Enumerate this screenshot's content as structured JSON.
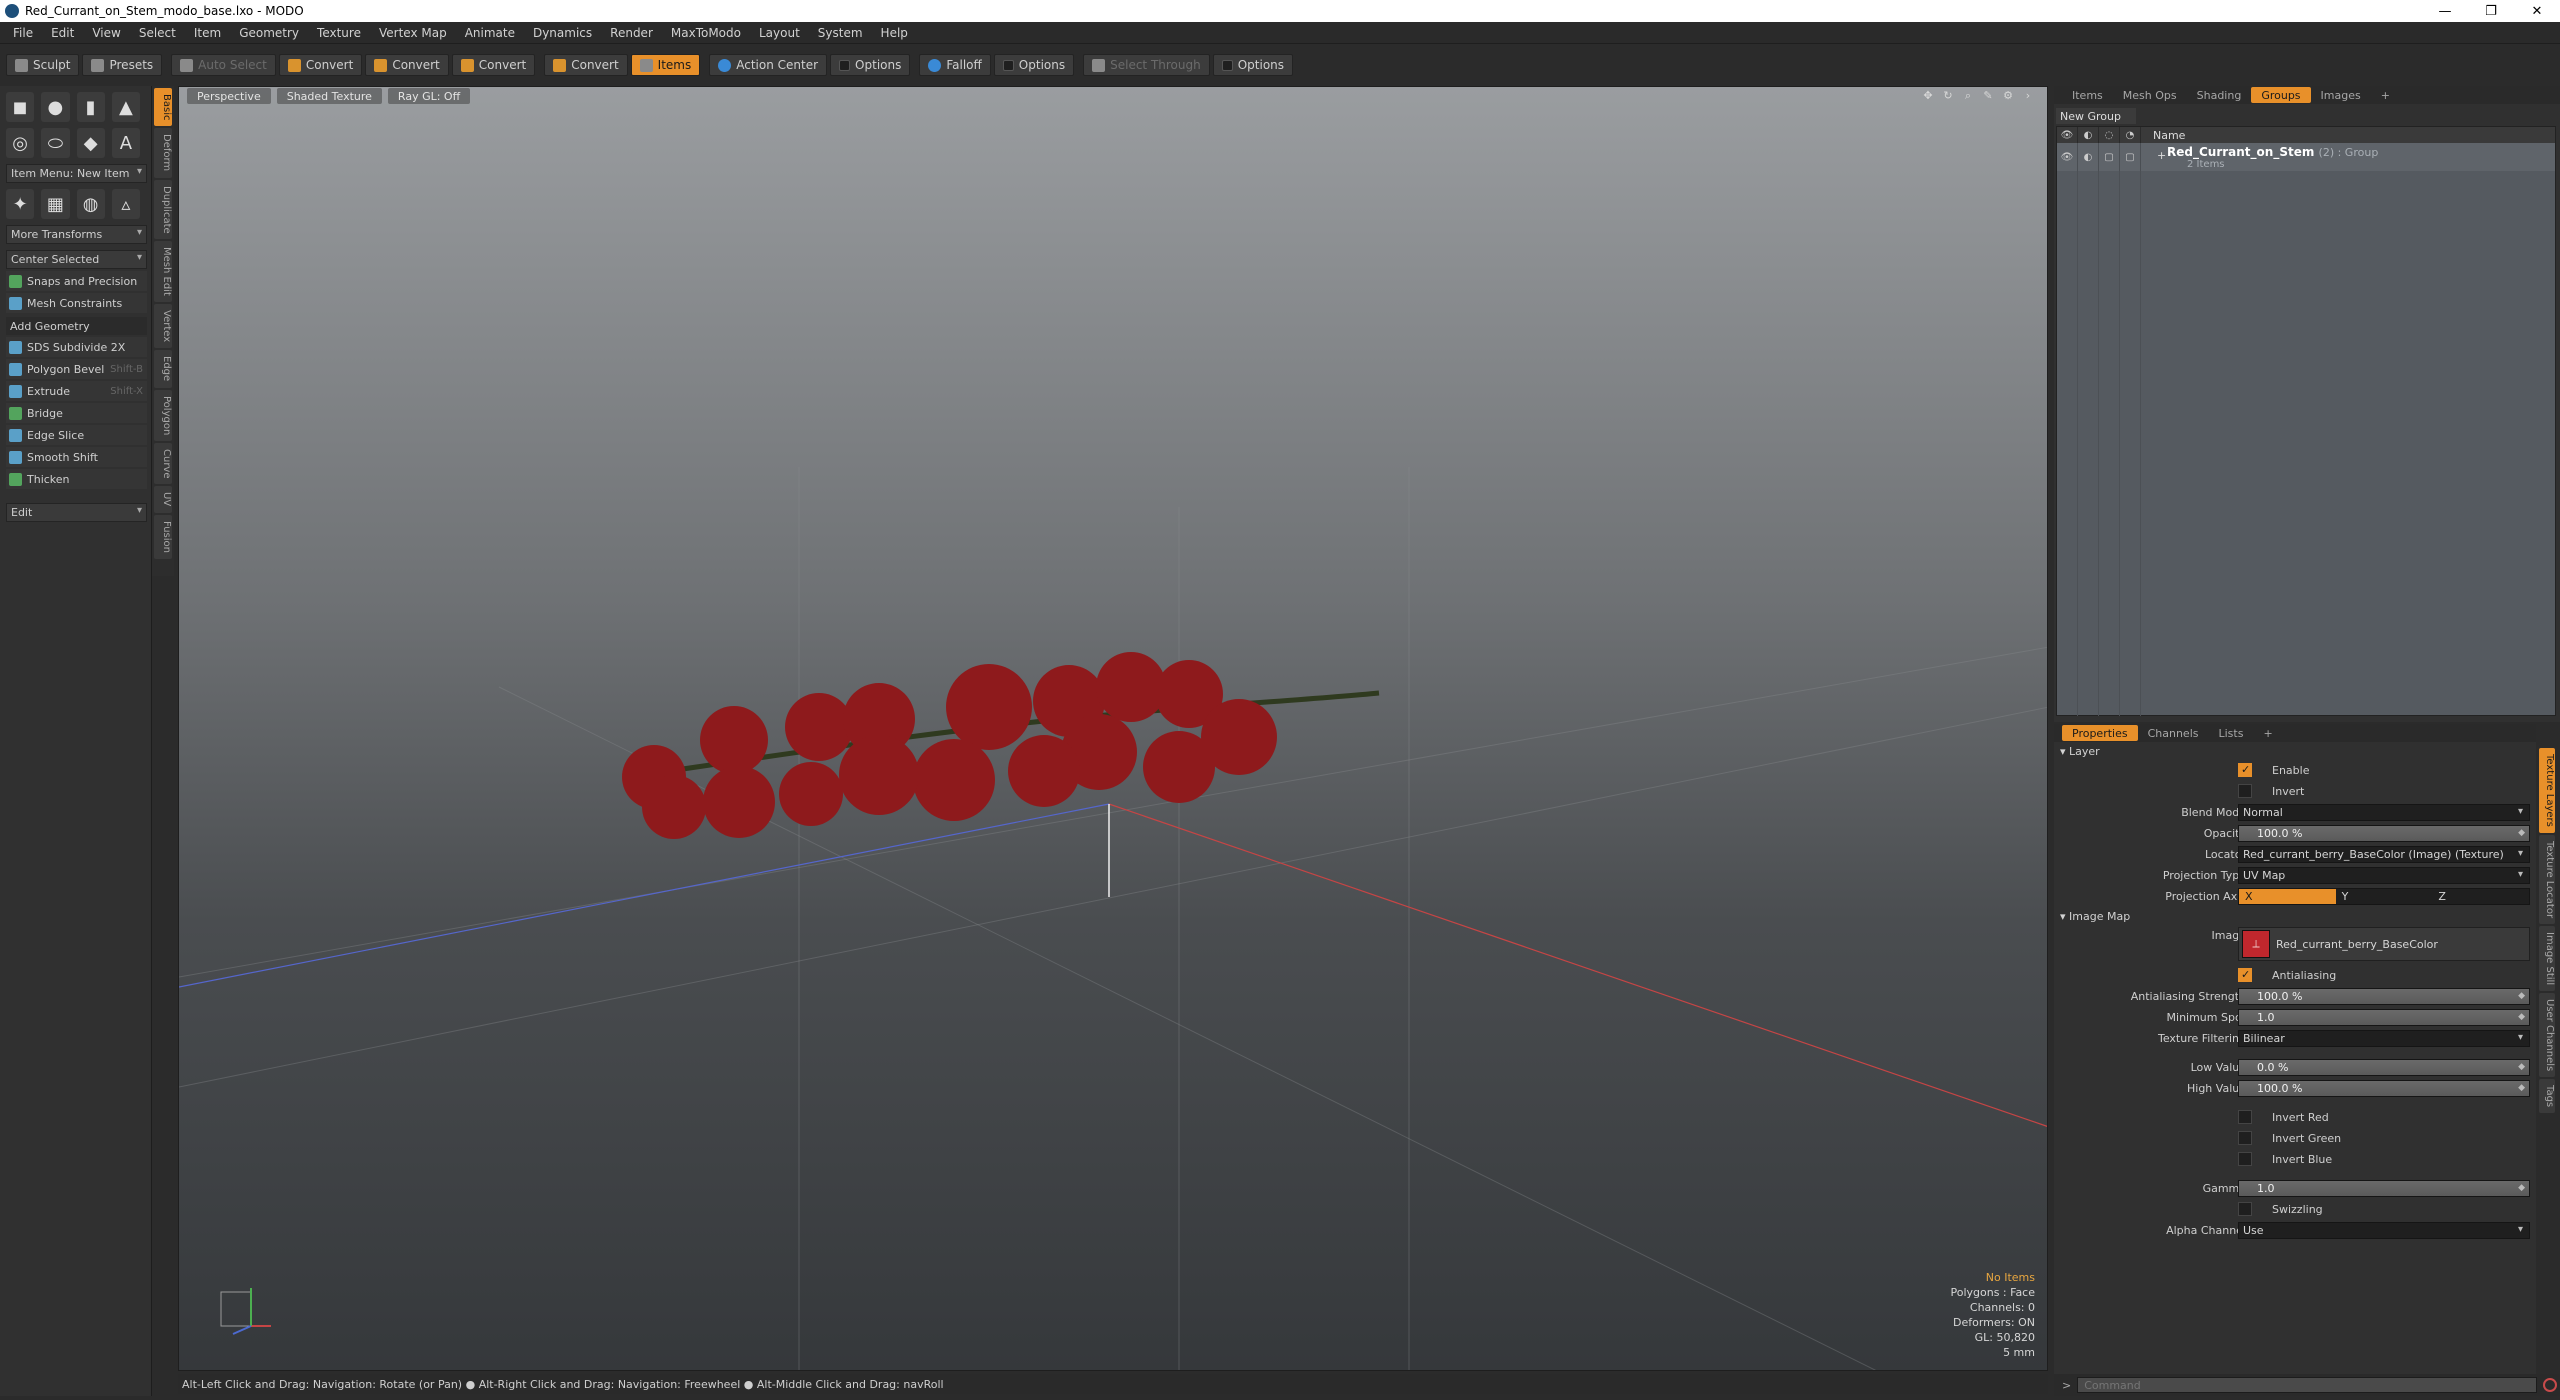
{
  "window": {
    "title": "Red_Currant_on_Stem_modo_base.lxo - MODO",
    "controls": [
      "—",
      "❐",
      "✕"
    ]
  },
  "menubar": [
    "File",
    "Edit",
    "View",
    "Select",
    "Item",
    "Geometry",
    "Texture",
    "Vertex Map",
    "Animate",
    "Dynamics",
    "Render",
    "MaxToModo",
    "Layout",
    "System",
    "Help"
  ],
  "toolbar": {
    "sculpt": "Sculpt",
    "presets": "Presets",
    "auto_select": "Auto Select",
    "convert1": "Convert",
    "convert2": "Convert",
    "convert3": "Convert",
    "convert4": "Convert",
    "items": "Items",
    "action_center": "Action Center",
    "options1": "Options",
    "falloff": "Falloff",
    "options2": "Options",
    "select_through": "Select Through",
    "options3": "Options"
  },
  "left_panel": {
    "item_menu": "Item Menu: New Item",
    "more_transforms": "More Transforms",
    "center_selected": "Center Selected",
    "snaps": "Snaps and Precision",
    "mesh_constraints": "Mesh Constraints",
    "add_geometry": "Add Geometry",
    "tools": [
      {
        "label": "SDS Subdivide 2X",
        "shortcut": ""
      },
      {
        "label": "Polygon Bevel",
        "shortcut": "Shift-B"
      },
      {
        "label": "Extrude",
        "shortcut": "Shift-X"
      },
      {
        "label": "Bridge",
        "shortcut": ""
      },
      {
        "label": "Edge Slice",
        "shortcut": ""
      },
      {
        "label": "Smooth Shift",
        "shortcut": ""
      },
      {
        "label": "Thicken",
        "shortcut": ""
      }
    ],
    "edit": "Edit",
    "vtabs": [
      "Basic",
      "Deform",
      "Duplicate",
      "Mesh Edit",
      "Vertex",
      "Edge",
      "Polygon",
      "Curve",
      "UV",
      "Fusion"
    ]
  },
  "viewport": {
    "tabs": [
      "Perspective",
      "Shaded Texture",
      "Ray GL: Off"
    ],
    "stats": {
      "no_items": "No Items",
      "polygons": "Polygons : Face",
      "channels": "Channels: 0",
      "deformers": "Deformers: ON",
      "gl": "GL: 50,820",
      "scale": "5 mm"
    },
    "colors": {
      "berry": "#8e1a1c",
      "stem": "#2f3a1f",
      "grid": "#8a8d90"
    }
  },
  "statusbar": "Alt-Left Click and Drag: Navigation: Rotate (or Pan) ● Alt-Right Click and Drag: Navigation: Freewheel ● Alt-Middle Click and Drag: navRoll",
  "right_top": {
    "tabs": [
      "Items",
      "Mesh Ops",
      "Shading",
      "Groups",
      "Images",
      "+"
    ],
    "new_group": "New Group",
    "column_name": "Name",
    "group": {
      "name": "Red_Currant_on_Stem",
      "suffix": "(2) : Group",
      "count": "2 Items"
    }
  },
  "properties": {
    "tabs": [
      "Properties",
      "Channels",
      "Lists",
      "+"
    ],
    "layer_section": "Layer",
    "enable": "Enable",
    "invert": "Invert",
    "blend_mode": {
      "label": "Blend Mode",
      "value": "Normal"
    },
    "opacity": {
      "label": "Opacity",
      "value": "100.0 %"
    },
    "locator": {
      "label": "Locator",
      "value": "Red_currant_berry_BaseColor (Image) (Texture)"
    },
    "projection_type": {
      "label": "Projection Type",
      "value": "UV Map"
    },
    "projection_axis": {
      "label": "Projection Axis",
      "x": "X",
      "y": "Y",
      "z": "Z"
    },
    "image_map_section": "Image Map",
    "image": {
      "label": "Image",
      "value": "Red_currant_berry_BaseColor"
    },
    "antialiasing": "Antialiasing",
    "aa_strength": {
      "label": "Antialiasing Strength",
      "value": "100.0 %"
    },
    "min_spot": {
      "label": "Minimum Spot",
      "value": "1.0"
    },
    "tex_filtering": {
      "label": "Texture Filtering",
      "value": "Bilinear"
    },
    "low_value": {
      "label": "Low Value",
      "value": "0.0 %"
    },
    "high_value": {
      "label": "High Value",
      "value": "100.0 %"
    },
    "invert_red": "Invert Red",
    "invert_green": "Invert Green",
    "invert_blue": "Invert Blue",
    "gamma": {
      "label": "Gamma",
      "value": "1.0"
    },
    "swizzling": "Swizzling",
    "alpha_channel": {
      "label": "Alpha Channel",
      "value": "Use"
    },
    "vtabs": [
      "Texture Layers",
      "Texture Locator",
      "Image Still",
      "User Channels",
      "Tags"
    ]
  },
  "command": {
    "prompt": ">",
    "placeholder": "Command"
  }
}
